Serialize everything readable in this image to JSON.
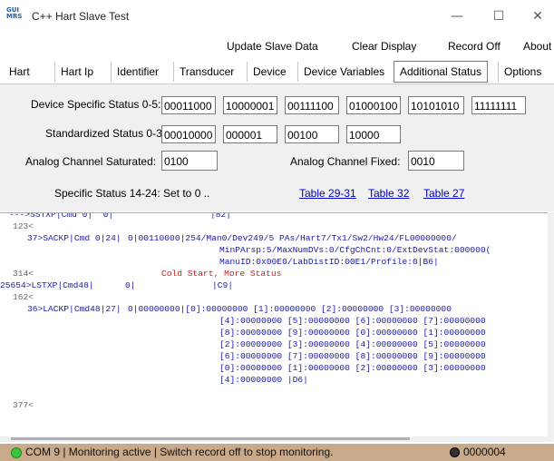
{
  "window": {
    "logo": "GUI MRS",
    "title": "C++ Hart Slave Test",
    "minimize": "—",
    "maximize": "☐",
    "close": "✕"
  },
  "toolbar": {
    "update": "Update Slave Data",
    "clear": "Clear Display",
    "record": "Record Off",
    "about": "About"
  },
  "tabs": [
    "Hart",
    "Hart Ip",
    "Identifier",
    "Transducer",
    "Device",
    "Device Variables",
    "Additional Status",
    "Options"
  ],
  "active_tab": "Additional Status",
  "status": {
    "device_specific_label": "Device Specific Status 0-5:",
    "device_specific": [
      "00011000",
      "10000001",
      "00111100",
      "01000100",
      "10101010",
      "11111111"
    ],
    "standardized_label": "Standardized Status 0-3:",
    "standardized": [
      "00010000",
      "000001",
      "00100",
      "10000"
    ],
    "analog_saturated_label": "Analog Channel Saturated:",
    "analog_saturated": "0100",
    "analog_fixed_label": "Analog Channel Fixed:",
    "analog_fixed": "0010",
    "specific_label": "Specific Status 14-24:",
    "specific_value": "Set to 0 ..",
    "links": [
      "Table 29-31",
      "Table 32",
      "Table 27"
    ]
  },
  "log": {
    "l1a": "--->SSTXP|Cmd 0|  0|",
    "l1b": "|82|",
    "l2": "123<",
    "l3a": "37>SACKP|Cmd 0|24|",
    "l3b": "0|00110000|254/Man0/Dev249/5 PAs/Hart7/Tx1/Sw2/Hw24/FL00000000/",
    "l4": "MinPArsp:5/MaxNumDVs:0/CfgChCnt:0/ExtDevStat:000000(",
    "l5": "ManuID:0x00E0/LabDistID:00E1/Profile:0|B6|",
    "l6a": "314<",
    "l6b": "Cold Start, More Status",
    "l7a": "25654>LSTXP|Cmd48|",
    "l7b": "0|",
    "l7c": "|C9|",
    "l8": "162<",
    "l9a": "36>LACKP|Cmd48|27|",
    "l9b": "0|00000000|[0]:00000000 [1]:00000000 [2]:00000000 [3]:00000000",
    "l10": "[4]:00000000 [5]:00000000 [6]:00000000 [7]:00000000",
    "l11": "[8]:00000000 [9]:00000000 [0]:00000000 [1]:00000000",
    "l12": "[2]:00000000 [3]:00000000 [4]:00000000 [5]:00000000",
    "l13": "[6]:00000000 [7]:00000000 [8]:00000000 [9]:00000000",
    "l14": "[0]:00000000 [1]:00000000 [2]:00000000 [3]:00000000",
    "l15": "[4]:00000000 |D6|",
    "l16": "377<"
  },
  "statusbar": {
    "text": "COM 9 | Monitoring active | Switch record off to stop monitoring.",
    "count": "0000004"
  },
  "colors": {
    "status_bar": "#c8a98a",
    "link": "#0000cc",
    "log_blue": "#1a1aa6",
    "log_red": "#cc2222"
  }
}
